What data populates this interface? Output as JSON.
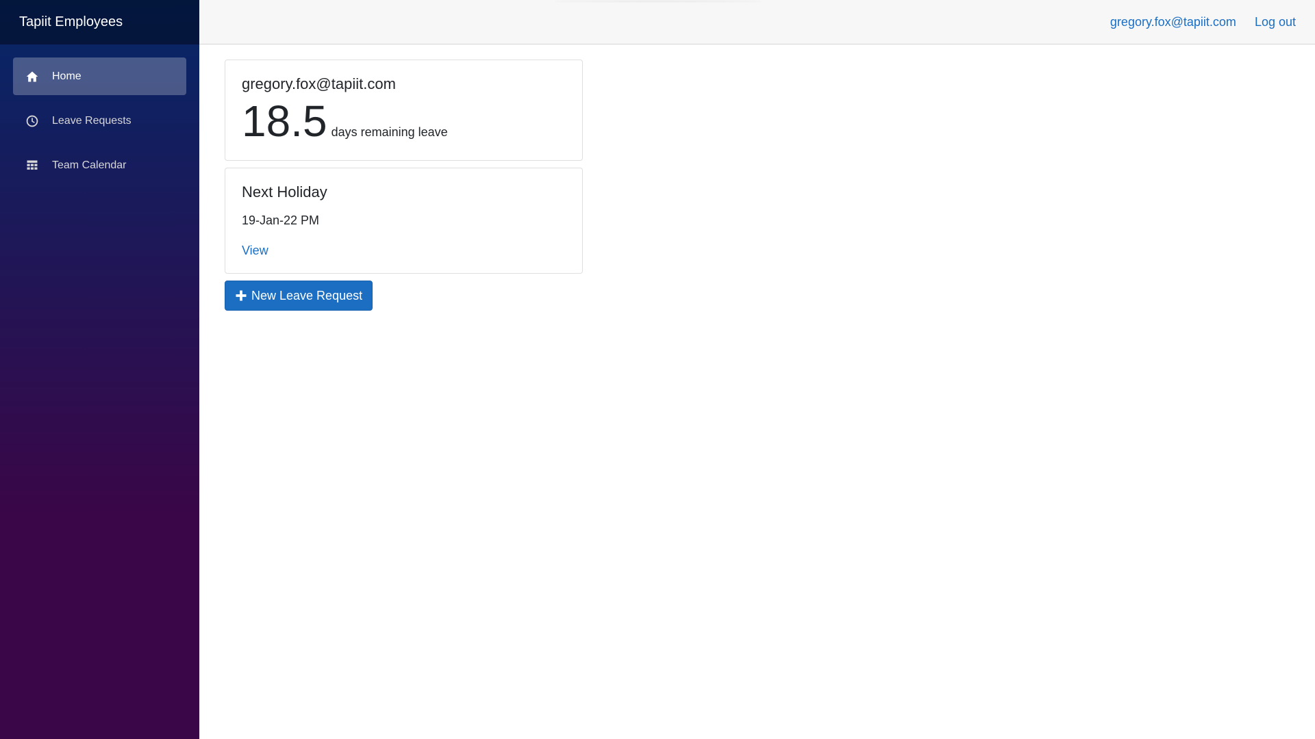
{
  "app": {
    "brand": "Tapiit Employees"
  },
  "sidebar": {
    "items": [
      {
        "label": "Home",
        "icon": "home-icon",
        "active": true
      },
      {
        "label": "Leave Requests",
        "icon": "clock-icon",
        "active": false
      },
      {
        "label": "Team Calendar",
        "icon": "calendar-icon",
        "active": false
      }
    ]
  },
  "header": {
    "user_email": "gregory.fox@tapiit.com",
    "logout_label": "Log out"
  },
  "leave_card": {
    "email": "gregory.fox@tapiit.com",
    "days": "18.5",
    "label": "days remaining leave"
  },
  "holiday_card": {
    "title": "Next Holiday",
    "date": "19-Jan-22 PM",
    "link_label": "View"
  },
  "actions": {
    "new_request_label": "New Leave Request",
    "new_request_icon": "plus-icon"
  },
  "colors": {
    "accent": "#1b6ec2",
    "sidebar_top": "#052767",
    "sidebar_bottom": "#3a0647"
  }
}
